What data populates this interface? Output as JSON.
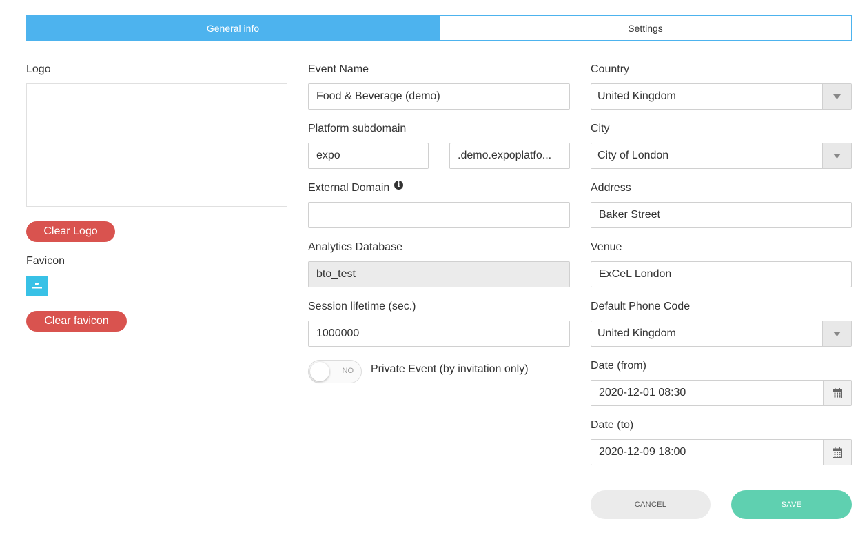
{
  "tabs": [
    {
      "label": "General info",
      "active": true
    },
    {
      "label": "Settings",
      "active": false
    }
  ],
  "left": {
    "logo_label": "Logo",
    "clear_logo": "Clear Logo",
    "favicon_label": "Favicon",
    "clear_favicon": "Clear favicon"
  },
  "middle": {
    "event_name_label": "Event Name",
    "event_name_value": "Food & Beverage (demo)",
    "subdomain_label": "Platform subdomain",
    "subdomain_value": "expo",
    "subdomain_suffix": ".demo.expoplatfo...",
    "external_domain_label": "External Domain",
    "external_domain_value": "",
    "analytics_label": "Analytics Database",
    "analytics_value": "bto_test",
    "session_label": "Session lifetime (sec.)",
    "session_value": "1000000",
    "private_toggle_text": "NO",
    "private_label": "Private Event (by invitation only)"
  },
  "right": {
    "country_label": "Country",
    "country_value": "United Kingdom",
    "city_label": "City",
    "city_value": "City of London",
    "address_label": "Address",
    "address_value": "Baker Street",
    "venue_label": "Venue",
    "venue_value": "ExCeL London",
    "phone_label": "Default Phone Code",
    "phone_value": "United Kingdom",
    "date_from_label": "Date (from)",
    "date_from_value": "2020-12-01 08:30",
    "date_to_label": "Date (to)",
    "date_to_value": "2020-12-09 18:00"
  },
  "actions": {
    "cancel": "CANCEL",
    "save": "SAVE"
  },
  "colors": {
    "tab_active": "#4db3ee",
    "danger": "#d9534f",
    "save": "#5fd0b0"
  }
}
